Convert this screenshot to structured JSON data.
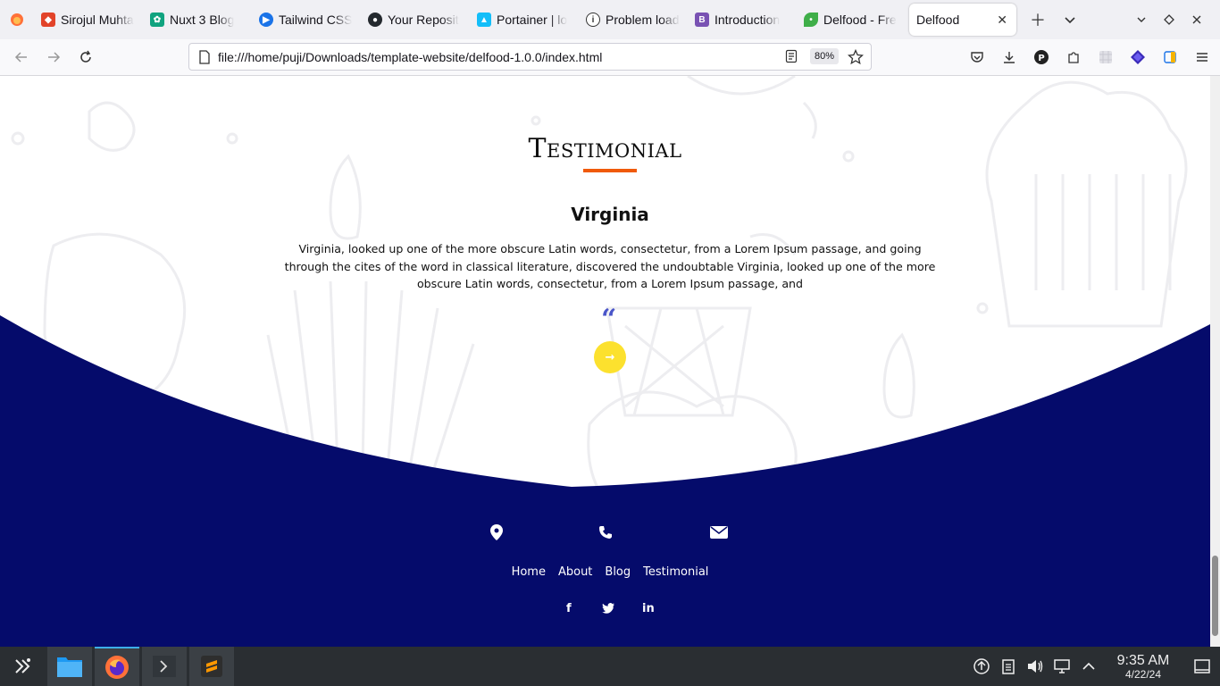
{
  "browser": {
    "tabs": [
      {
        "title": "Sirojul Muhta",
        "icon": "gitlab-icon",
        "color": "#e24329"
      },
      {
        "title": "Nuxt 3 Blog",
        "icon": "openai-icon",
        "color": "#10a37f"
      },
      {
        "title": "Tailwind CSS",
        "icon": "play-icon",
        "color": "#1a73e8"
      },
      {
        "title": "Your Reposit",
        "icon": "github-icon",
        "color": "#24292e"
      },
      {
        "title": "Portainer | lo",
        "icon": "portainer-icon",
        "color": "#13bef9"
      },
      {
        "title": "Problem load",
        "icon": "info-icon",
        "color": "#444444"
      },
      {
        "title": "Introduction",
        "icon": "bootstrap-icon",
        "color": "#7952b3"
      },
      {
        "title": "Delfood - Fre",
        "icon": "leaf-icon",
        "color": "#3fae49"
      },
      {
        "title": "Delfood",
        "icon": "",
        "color": "",
        "active": true
      }
    ],
    "url": "file:///home/puji/Downloads/template-website/delfood-1.0.0/index.html",
    "zoom": "80%"
  },
  "page": {
    "section_title": "Testimonial",
    "name": "Virginia",
    "quote": "Virginia, looked up one of the more obscure Latin words, consectetur, from a Lorem Ipsum passage, and going through the cites of the word in classical literature, discovered the undoubtable Virginia, looked up one of the more obscure Latin words, consectetur, from a Lorem Ipsum passage, and",
    "quote_mark": "“",
    "next_arrow": "→",
    "accent_color": "#f05a0a",
    "footer_color": "#050b6b",
    "button_color": "#fce12e"
  },
  "footer": {
    "contact_icons": [
      "map-marker-icon",
      "phone-icon",
      "envelope-icon"
    ],
    "links": [
      "Home",
      "About",
      "Blog",
      "Testimonial"
    ],
    "social": {
      "facebook": "f",
      "twitter": "twitter-icon",
      "linkedin": "in"
    }
  },
  "taskbar": {
    "apps": [
      "app-launcher-icon",
      "file-manager-icon",
      "firefox-icon",
      "terminal-icon",
      "sublime-text-icon"
    ],
    "time": "9:35 AM",
    "date": "4/22/24"
  }
}
